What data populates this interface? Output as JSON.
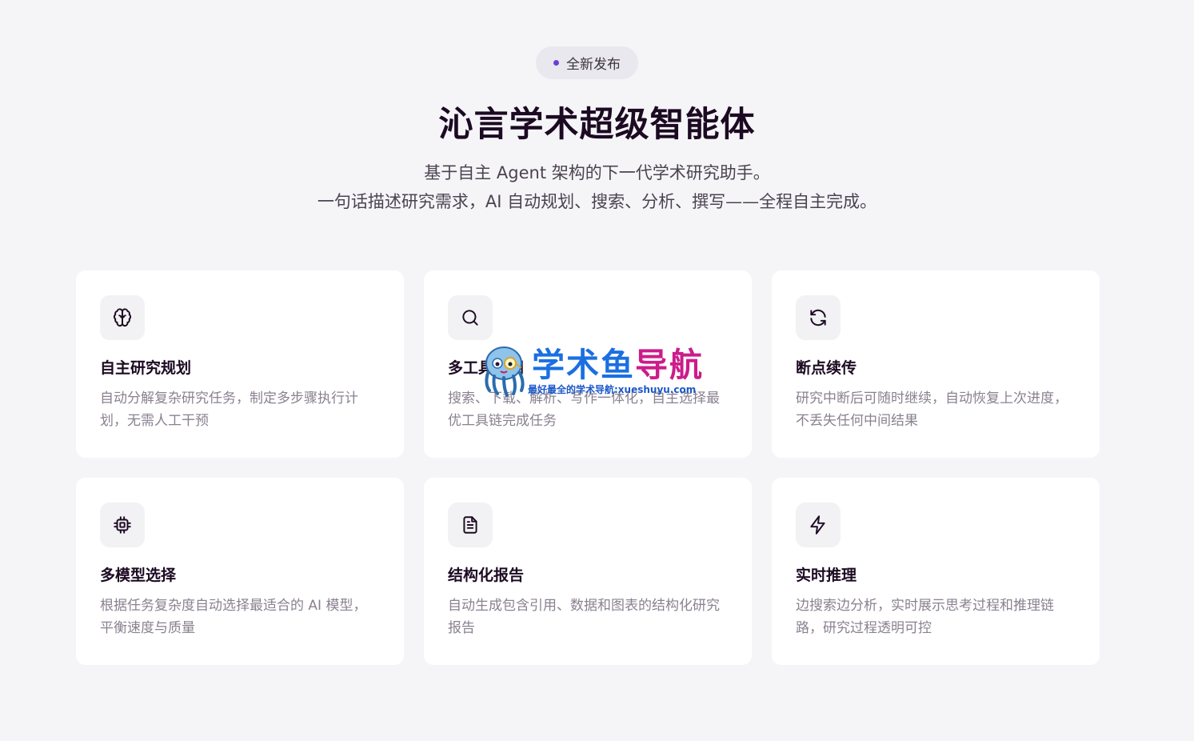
{
  "badge": {
    "label": "全新发布",
    "dot_color": "#6a3fd9"
  },
  "hero": {
    "title": "沁言学术超级智能体",
    "subtitle_line1": "基于自主 Agent 架构的下一代学术研究助手。",
    "subtitle_line2": "一句话描述研究需求，AI 自动规划、搜索、分析、撰写——全程自主完成。"
  },
  "features": [
    {
      "icon": "brain-icon",
      "title": "自主研究规划",
      "description": "自动分解复杂研究任务，制定多步骤执行计划，无需人工干预"
    },
    {
      "icon": "search-icon",
      "title": "多工具协同",
      "description": "搜索、下载、解析、写作一体化，自主选择最优工具链完成任务"
    },
    {
      "icon": "refresh-icon",
      "title": "断点续传",
      "description": "研究中断后可随时继续，自动恢复上次进度，不丢失任何中间结果"
    },
    {
      "icon": "cpu-icon",
      "title": "多模型选择",
      "description": "根据任务复杂度自动选择最适合的 AI 模型，平衡速度与质量"
    },
    {
      "icon": "document-icon",
      "title": "结构化报告",
      "description": "自动生成包含引用、数据和图表的结构化研究报告"
    },
    {
      "icon": "lightning-icon",
      "title": "实时推理",
      "description": "边搜索边分析，实时展示思考过程和推理链路，研究过程透明可控"
    }
  ],
  "watermark": {
    "title_part1": "学术鱼",
    "title_part2": "导航",
    "tagline": "最好最全的学术导航:xueshuyu.com",
    "colors": {
      "blue": "#1b6fe0",
      "pink": "#cc1c8b"
    }
  }
}
